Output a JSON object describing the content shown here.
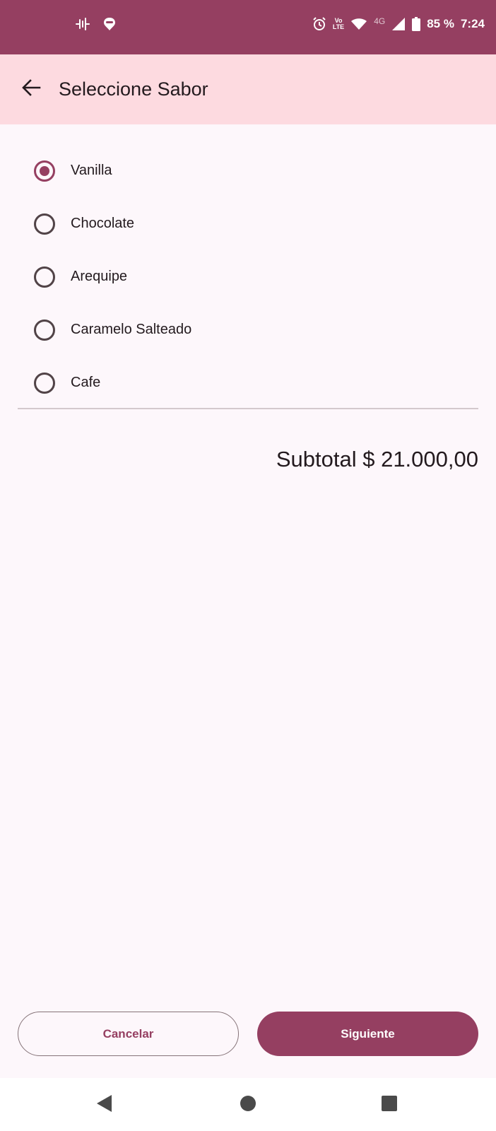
{
  "status_bar": {
    "battery": "85 %",
    "time": "7:24",
    "network": "4G",
    "volte_top": "Vo",
    "volte_bottom": "LTE",
    "icons": [
      "waveform-icon",
      "notification-icon",
      "alarm-icon",
      "volte-icon",
      "wifi-icon",
      "signal-icon",
      "battery-icon"
    ]
  },
  "app_bar": {
    "title": "Seleccione Sabor",
    "back_icon": "arrow-back-icon"
  },
  "flavors": {
    "selected": "Vanilla",
    "options": [
      {
        "label": "Vanilla",
        "checked": true
      },
      {
        "label": "Chocolate",
        "checked": false
      },
      {
        "label": "Arequipe",
        "checked": false
      },
      {
        "label": "Caramelo Salteado",
        "checked": false
      },
      {
        "label": "Cafe",
        "checked": false
      }
    ]
  },
  "subtotal": "Subtotal $ 21.000,00",
  "actions": {
    "cancel": "Cancelar",
    "next": "Siguiente"
  },
  "nav_bar": {
    "icons": [
      "back-triangle-icon",
      "home-circle-icon",
      "recents-square-icon"
    ]
  },
  "colors": {
    "primary": "#953f61",
    "app_bar_bg": "#fddae0",
    "background": "#fdf7fb"
  }
}
